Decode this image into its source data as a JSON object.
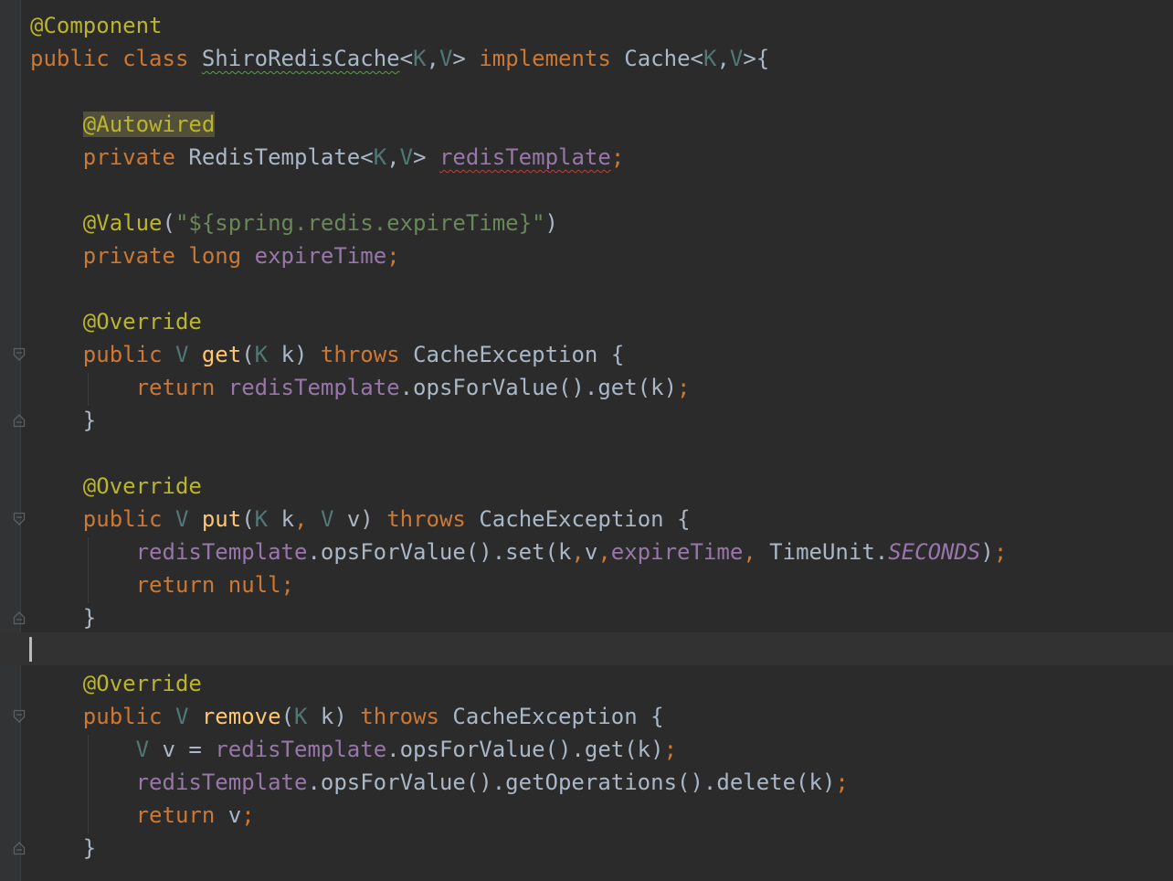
{
  "editor": {
    "lines": [
      [
        {
          "t": "@Component",
          "k": "ann"
        }
      ],
      [
        {
          "t": "public",
          "k": "kw"
        },
        {
          "t": " "
        },
        {
          "t": "class",
          "k": "kw"
        },
        {
          "t": " "
        },
        {
          "t": "ShiroRedisCache",
          "k": "typ wavy-green"
        },
        {
          "t": "<"
        },
        {
          "t": "K",
          "k": "tp"
        },
        {
          "t": ","
        },
        {
          "t": "V",
          "k": "tp"
        },
        {
          "t": "> "
        },
        {
          "t": "implements",
          "k": "kw"
        },
        {
          "t": " Cache<"
        },
        {
          "t": "K",
          "k": "tp"
        },
        {
          "t": ","
        },
        {
          "t": "V",
          "k": "tp"
        },
        {
          "t": ">{"
        }
      ],
      [],
      [
        {
          "t": "    "
        },
        {
          "t": "@Autowired",
          "k": "ann ann-highlight"
        }
      ],
      [
        {
          "t": "    "
        },
        {
          "t": "private",
          "k": "kw"
        },
        {
          "t": " RedisTemplate<"
        },
        {
          "t": "K",
          "k": "tp"
        },
        {
          "t": ","
        },
        {
          "t": "V",
          "k": "tp"
        },
        {
          "t": "> "
        },
        {
          "t": "redisTemplate",
          "k": "fld wavy-red"
        },
        {
          "t": ";",
          "k": "kw"
        }
      ],
      [],
      [
        {
          "t": "    "
        },
        {
          "t": "@Value",
          "k": "ann"
        },
        {
          "t": "("
        },
        {
          "t": "\"${spring.redis.expireTime}\"",
          "k": "str"
        },
        {
          "t": ")"
        }
      ],
      [
        {
          "t": "    "
        },
        {
          "t": "private",
          "k": "kw"
        },
        {
          "t": " "
        },
        {
          "t": "long",
          "k": "kw"
        },
        {
          "t": " "
        },
        {
          "t": "expireTime",
          "k": "fld"
        },
        {
          "t": ";",
          "k": "kw"
        }
      ],
      [],
      [
        {
          "t": "    "
        },
        {
          "t": "@Override",
          "k": "ann"
        }
      ],
      [
        {
          "t": "    "
        },
        {
          "t": "public",
          "k": "kw"
        },
        {
          "t": " "
        },
        {
          "t": "V",
          "k": "tp"
        },
        {
          "t": " "
        },
        {
          "t": "get",
          "k": "fn"
        },
        {
          "t": "("
        },
        {
          "t": "K",
          "k": "tp"
        },
        {
          "t": " k) "
        },
        {
          "t": "throws",
          "k": "kw"
        },
        {
          "t": " CacheException {"
        }
      ],
      [
        {
          "t": "        "
        },
        {
          "t": "return",
          "k": "kw"
        },
        {
          "t": " "
        },
        {
          "t": "redisTemplate",
          "k": "fld"
        },
        {
          "t": ".opsForValue().get(k)"
        },
        {
          "t": ";",
          "k": "kw"
        }
      ],
      [
        {
          "t": "    }"
        }
      ],
      [],
      [
        {
          "t": "    "
        },
        {
          "t": "@Override",
          "k": "ann"
        }
      ],
      [
        {
          "t": "    "
        },
        {
          "t": "public",
          "k": "kw"
        },
        {
          "t": " "
        },
        {
          "t": "V",
          "k": "tp"
        },
        {
          "t": " "
        },
        {
          "t": "put",
          "k": "fn"
        },
        {
          "t": "("
        },
        {
          "t": "K",
          "k": "tp"
        },
        {
          "t": " k"
        },
        {
          "t": ",",
          "k": "kw"
        },
        {
          "t": " "
        },
        {
          "t": "V",
          "k": "tp"
        },
        {
          "t": " v) "
        },
        {
          "t": "throws",
          "k": "kw"
        },
        {
          "t": " CacheException {"
        }
      ],
      [
        {
          "t": "        "
        },
        {
          "t": "redisTemplate",
          "k": "fld"
        },
        {
          "t": ".opsForValue().set(k"
        },
        {
          "t": ",",
          "k": "kw"
        },
        {
          "t": "v"
        },
        {
          "t": ",",
          "k": "kw"
        },
        {
          "t": "expireTime",
          "k": "fld"
        },
        {
          "t": ",",
          "k": "kw"
        },
        {
          "t": " TimeUnit."
        },
        {
          "t": "SECONDS",
          "k": "const"
        },
        {
          "t": ")"
        },
        {
          "t": ";",
          "k": "kw"
        }
      ],
      [
        {
          "t": "        "
        },
        {
          "t": "return",
          "k": "kw"
        },
        {
          "t": " "
        },
        {
          "t": "null",
          "k": "kw"
        },
        {
          "t": ";",
          "k": "kw"
        }
      ],
      [
        {
          "t": "    }"
        }
      ],
      [],
      [
        {
          "t": "    "
        },
        {
          "t": "@Override",
          "k": "ann"
        }
      ],
      [
        {
          "t": "    "
        },
        {
          "t": "public",
          "k": "kw"
        },
        {
          "t": " "
        },
        {
          "t": "V",
          "k": "tp"
        },
        {
          "t": " "
        },
        {
          "t": "remove",
          "k": "fn"
        },
        {
          "t": "("
        },
        {
          "t": "K",
          "k": "tp"
        },
        {
          "t": " k) "
        },
        {
          "t": "throws",
          "k": "kw"
        },
        {
          "t": " CacheException {"
        }
      ],
      [
        {
          "t": "        "
        },
        {
          "t": "V",
          "k": "tp"
        },
        {
          "t": " v = "
        },
        {
          "t": "redisTemplate",
          "k": "fld"
        },
        {
          "t": ".opsForValue().get(k)"
        },
        {
          "t": ";",
          "k": "kw"
        }
      ],
      [
        {
          "t": "        "
        },
        {
          "t": "redisTemplate",
          "k": "fld"
        },
        {
          "t": ".opsForValue().getOperations().delete(k)"
        },
        {
          "t": ";",
          "k": "kw"
        }
      ],
      [
        {
          "t": "        "
        },
        {
          "t": "return",
          "k": "kw"
        },
        {
          "t": " v"
        },
        {
          "t": ";",
          "k": "kw"
        }
      ],
      [
        {
          "t": "    }"
        }
      ]
    ]
  },
  "colors": {
    "background": "#2b2b2b",
    "keyword": "#cc7832",
    "annotation": "#bbb529",
    "text": "#a9b7c6",
    "type_param": "#507874",
    "field": "#9876aa",
    "method": "#ffc66d",
    "string": "#6a8759"
  },
  "icons": [
    "fold-start-icon",
    "fold-end-icon",
    "text-caret"
  ]
}
